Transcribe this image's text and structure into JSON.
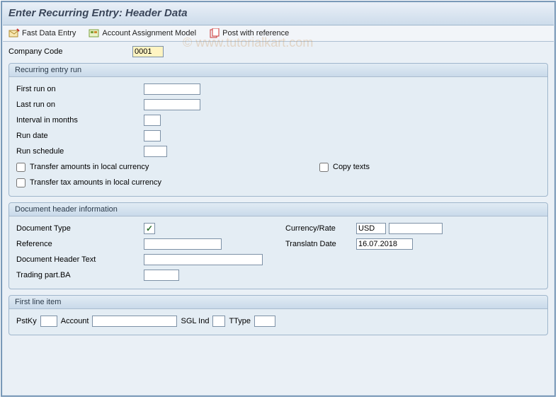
{
  "title": "Enter Recurring Entry: Header Data",
  "watermark": "© www.tutorialkart.com",
  "toolbar": {
    "fast_entry": "Fast Data Entry",
    "aam": "Account Assignment Model",
    "post_ref": "Post with reference"
  },
  "top": {
    "company_code_label": "Company Code",
    "company_code_value": "0001"
  },
  "group_run": {
    "title": "Recurring entry run",
    "first_run_label": "First run on",
    "first_run_value": "",
    "last_run_label": "Last run on",
    "last_run_value": "",
    "interval_label": "Interval in months",
    "interval_value": "",
    "run_date_label": "Run date",
    "run_date_value": "",
    "run_schedule_label": "Run schedule",
    "run_schedule_value": "",
    "xfer_local_label": "Transfer amounts in local currency",
    "copy_texts_label": "Copy texts",
    "xfer_tax_label": "Transfer tax amounts in local currency"
  },
  "group_doc": {
    "title": "Document header information",
    "doc_type_label": "Document Type",
    "currency_label": "Currency/Rate",
    "currency_value": "USD",
    "rate_value": "",
    "ref_label": "Reference",
    "ref_value": "",
    "trdate_label": "Translatn Date",
    "trdate_value": "16.07.2018",
    "header_text_label": "Document Header Text",
    "header_text_value": "",
    "trading_label": "Trading part.BA",
    "trading_value": ""
  },
  "group_line": {
    "title": "First line item",
    "pstky_label": "PstKy",
    "pstky_value": "",
    "account_label": "Account",
    "account_value": "",
    "sgl_label": "SGL Ind",
    "sgl_value": "",
    "ttype_label": "TType",
    "ttype_value": ""
  }
}
